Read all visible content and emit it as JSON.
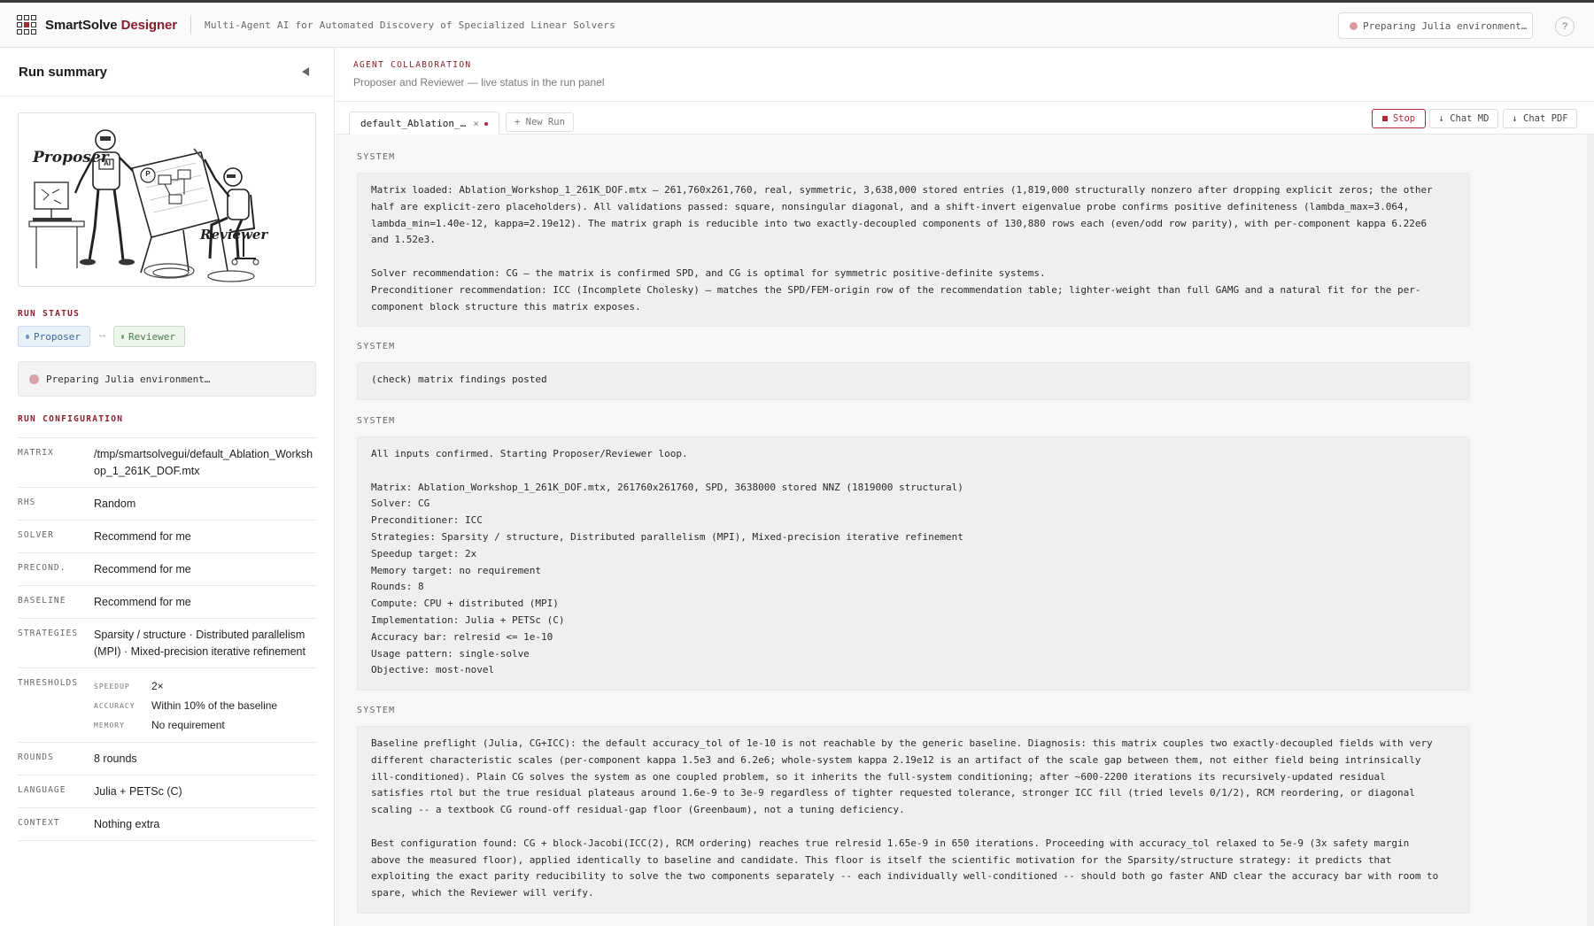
{
  "app": {
    "brand_prefix": "SmartSolve",
    "brand_accent": "Designer",
    "tagline": "Multi-Agent AI for Automated Discovery of Specialized Linear Solvers",
    "env_status": "Preparing Julia environment…",
    "help_label": "?"
  },
  "sidebar": {
    "title": "Run summary",
    "hero": {
      "proposer_label": "Proposer",
      "reviewer_label": "Reviewer",
      "ai_badge": "AI",
      "p_badge": "P"
    },
    "run_status_label": "RUN STATUS",
    "agents": {
      "proposer": "Proposer",
      "reviewer": "Reviewer",
      "arrow": "↔"
    },
    "status_text": "Preparing Julia environment…",
    "config_label": "RUN CONFIGURATION",
    "config": {
      "matrix_key": "MATRIX",
      "matrix": "/tmp/smartsolvegui/default_Ablation_Workshop_1_261K_DOF.mtx",
      "rhs_key": "RHS",
      "rhs": "Random",
      "solver_key": "SOLVER",
      "solver": "Recommend for me",
      "precond_key": "PRECOND.",
      "precond": "Recommend for me",
      "baseline_key": "BASELINE",
      "baseline": "Recommend for me",
      "strategies_key": "STRATEGIES",
      "strategies": "Sparsity / structure · Distributed parallelism (MPI) · Mixed-precision iterative refinement",
      "thresholds_key": "THRESHOLDS",
      "thresholds": {
        "speedup_key": "SPEEDUP",
        "speedup": "2×",
        "accuracy_key": "ACCURACY",
        "accuracy": "Within 10% of the baseline",
        "memory_key": "MEMORY",
        "memory": "No requirement"
      },
      "rounds_key": "ROUNDS",
      "rounds": "8 rounds",
      "language_key": "LANGUAGE",
      "language": "Julia + PETSc (C)",
      "context_key": "CONTEXT",
      "context": "Nothing extra"
    }
  },
  "main": {
    "eyebrow": "AGENT COLLABORATION",
    "subtitle": "Proposer and Reviewer — live status in the run panel",
    "tab_label": "default_Ablation_…",
    "tab_close": "×",
    "new_run": "+ New Run",
    "stop": "Stop",
    "chat_md": "↓ Chat MD",
    "chat_pdf": "↓ Chat PDF"
  },
  "messages": [
    {
      "sender": "SYSTEM",
      "text": "Matrix loaded: Ablation_Workshop_1_261K_DOF.mtx — 261,760x261,760, real, symmetric, 3,638,000 stored entries (1,819,000 structurally nonzero after dropping explicit zeros; the other\nhalf are explicit-zero placeholders). All validations passed: square, nonsingular diagonal, and a shift-invert eigenvalue probe confirms positive definiteness (lambda_max=3.064,\nlambda_min=1.40e-12, kappa=2.19e12). The matrix graph is reducible into two exactly-decoupled components of 130,880 rows each (even/odd row parity), with per-component kappa 6.22e6\nand 1.52e3.\n\nSolver recommendation: CG — the matrix is confirmed SPD, and CG is optimal for symmetric positive-definite systems.\nPreconditioner recommendation: ICC (Incomplete Cholesky) — matches the SPD/FEM-origin row of the recommendation table; lighter-weight than full GAMG and a natural fit for the per-\ncomponent block structure this matrix exposes."
    },
    {
      "sender": "SYSTEM",
      "text": "(check) matrix findings posted"
    },
    {
      "sender": "SYSTEM",
      "text": "All inputs confirmed. Starting Proposer/Reviewer loop.\n\nMatrix: Ablation_Workshop_1_261K_DOF.mtx, 261760x261760, SPD, 3638000 stored NNZ (1819000 structural)\nSolver: CG\nPreconditioner: ICC\nStrategies: Sparsity / structure, Distributed parallelism (MPI), Mixed-precision iterative refinement\nSpeedup target: 2x\nMemory target: no requirement\nRounds: 8\nCompute: CPU + distributed (MPI)\nImplementation: Julia + PETSc (C)\nAccuracy bar: relresid <= 1e-10\nUsage pattern: single-solve\nObjective: most-novel"
    },
    {
      "sender": "SYSTEM",
      "text": "Baseline preflight (Julia, CG+ICC): the default accuracy_tol of 1e-10 is not reachable by the generic baseline. Diagnosis: this matrix couples two exactly-decoupled fields with very\ndifferent characteristic scales (per-component kappa 1.5e3 and 6.2e6; whole-system kappa 2.19e12 is an artifact of the scale gap between them, not either field being intrinsically\nill-conditioned). Plain CG solves the system as one coupled problem, so it inherits the full-system conditioning; after ~600-2200 iterations its recursively-updated residual\nsatisfies rtol but the true residual plateaus around 1.6e-9 to 3e-9 regardless of tighter requested tolerance, stronger ICC fill (tried levels 0/1/2), RCM reordering, or diagonal\nscaling -- a textbook CG round-off residual-gap floor (Greenbaum), not a tuning deficiency.\n\nBest configuration found: CG + block-Jacobi(ICC(2), RCM ordering) reaches true relresid 1.65e-9 in 650 iterations. Proceeding with accuracy_tol relaxed to 5e-9 (3x safety margin\nabove the measured floor), applied identically to baseline and candidate. This floor is itself the scientific motivation for the Sparsity/structure strategy: it predicts that\nexploiting the exact parity reducibility to solve the two components separately -- each individually well-conditioned -- should both go faster AND clear the accuracy bar with room to\nspare, which the Reviewer will verify."
    }
  ]
}
